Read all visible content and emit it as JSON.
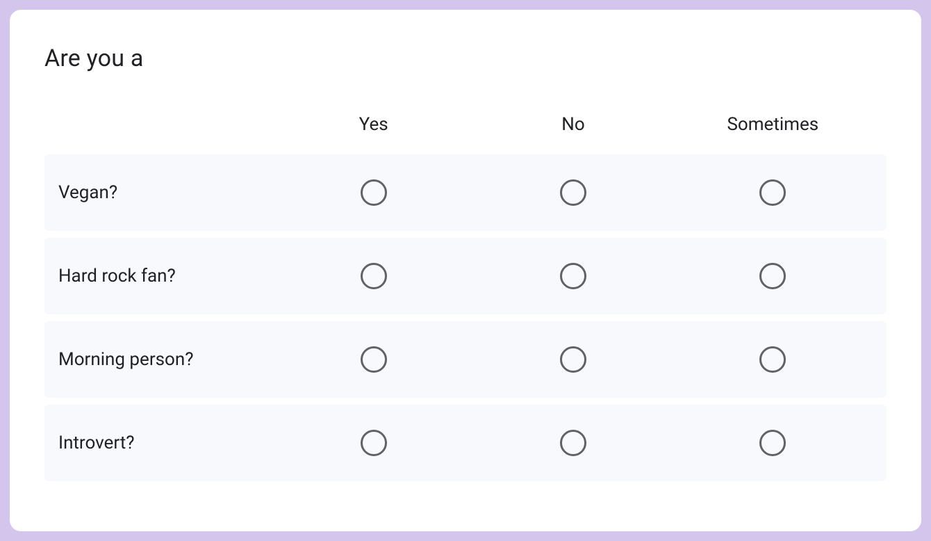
{
  "question": {
    "title": "Are you a",
    "columns": [
      "Yes",
      "No",
      "Sometimes"
    ],
    "rows": [
      "Vegan?",
      "Hard rock fan?",
      "Morning person?",
      "Introvert?"
    ]
  }
}
